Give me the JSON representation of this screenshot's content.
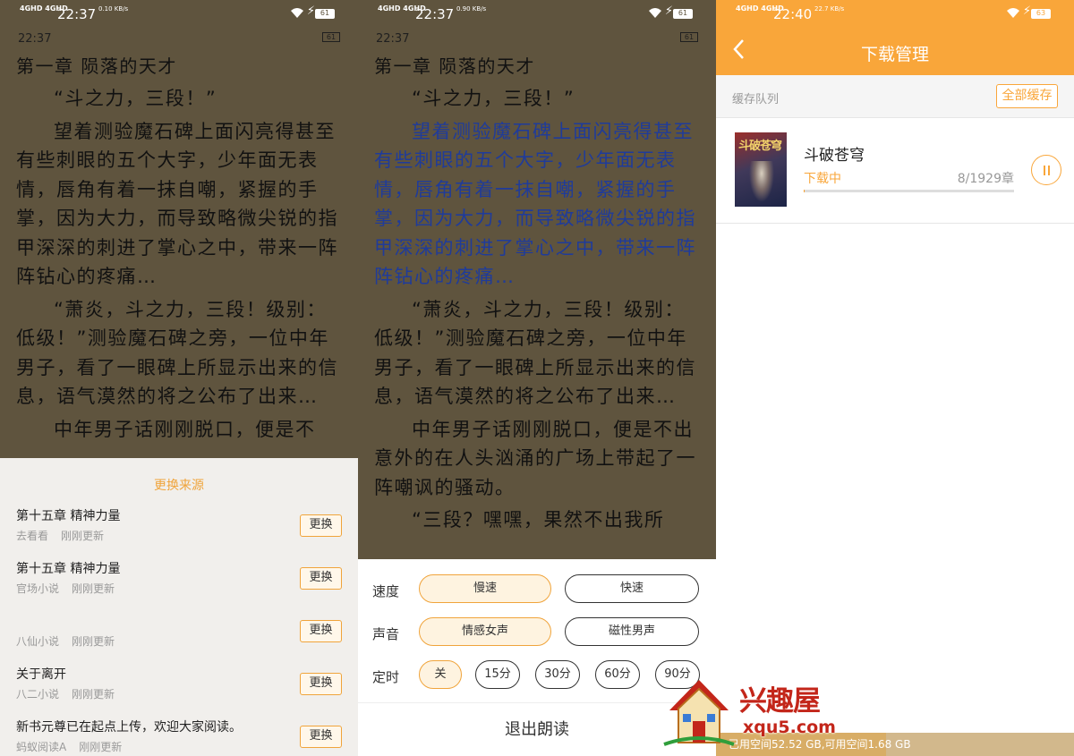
{
  "status_bar": {
    "net": "4GHD 4GHD",
    "panel1": {
      "time": "22:37",
      "speed": "0.10 KB/s",
      "battery": "61"
    },
    "panel2": {
      "time": "22:37",
      "speed": "0.90 KB/s",
      "battery": "61"
    },
    "panel3": {
      "time": "22:40",
      "speed": "22.7 KB/s",
      "battery": "63"
    }
  },
  "reader": {
    "header_time": "22:37",
    "header_battery": "61",
    "chapter_title": "第一章 陨落的天才",
    "p1": "“斗之力，三段！”",
    "p2": "望着测验魔石碑上面闪亮得甚至有些刺眼的五个大字，少年面无表情，唇角有着一抹自嘲，紧握的手掌，因为大力，而导致略微尖锐的指甲深深的刺进了掌心之中，带来一阵阵钻心的疼痛…",
    "p3": "“萧炎，斗之力，三段！级别：低级！”测验魔石碑之旁，一位中年男子，看了一眼碑上所显示出来的信息，语气漠然的将之公布了出来…",
    "p4": "中年男子话刚刚脱口，便是不出意外的在人头汹涌的广场上带起了一阵嘲讽的骚动。",
    "p5": "“三段？嘿嘿，果然不出我所",
    "p4_peek": "中年男子话刚刚脱口，便是不"
  },
  "source_sheet": {
    "title": "更换来源",
    "items": [
      {
        "title": "第十五章 精神力量",
        "source": "去看看",
        "updated": "刚刚更新",
        "button": "更换"
      },
      {
        "title": "第十五章 精神力量",
        "source": "官场小说",
        "updated": "刚刚更新",
        "button": "更换"
      },
      {
        "title": "",
        "source": "八仙小说",
        "updated": "刚刚更新",
        "button": "更换"
      },
      {
        "title": "关于离开",
        "source": "八二小说",
        "updated": "刚刚更新",
        "button": "更换"
      },
      {
        "title": "新书元尊已在起点上传，欢迎大家阅读。",
        "source": "蚂蚁阅读A",
        "updated": "刚刚更新",
        "button": "更换"
      }
    ]
  },
  "tts_sheet": {
    "speed_label": "速度",
    "speed_options": [
      "慢速",
      "快速"
    ],
    "speed_selected": "慢速",
    "voice_label": "声音",
    "voice_options": [
      "情感女声",
      "磁性男声"
    ],
    "voice_selected": "情感女声",
    "timer_label": "定时",
    "timer_options": [
      "关",
      "15分",
      "30分",
      "60分",
      "90分"
    ],
    "timer_selected": "关",
    "exit_label": "退出朗读"
  },
  "download": {
    "title": "下载管理",
    "queue_label": "缓存队列",
    "cache_all_button": "全部缓存",
    "book": {
      "name": "斗破苍穹",
      "cover_text": "斗破苍穹",
      "state": "下载中",
      "count": "8/1929章",
      "progress": 0.0042
    },
    "storage_text": "已用空间52.52 GB,可用空间1.68 GB"
  },
  "watermark": {
    "cn": "兴趣屋",
    "url": "xqu5.com"
  },
  "colors": {
    "accent": "#f9a63a",
    "reader_bg": "#5f543e",
    "highlight_text": "#1f3b9a"
  }
}
